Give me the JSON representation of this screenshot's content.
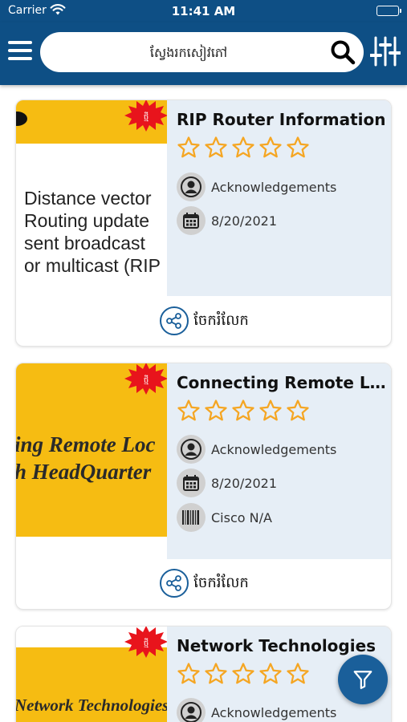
{
  "status_bar": {
    "carrier": "Carrier",
    "time": "11:41 AM"
  },
  "search": {
    "placeholder": "ស្វែងរកសៀវភៅ"
  },
  "colors": {
    "primary": "#0e4f85",
    "accent_yellow": "#f6bc12",
    "star": "#f5a623",
    "badge_red": "#e8141c",
    "info_bg": "#e6eef6"
  },
  "share_label": "ចែករំលែក",
  "cards": [
    {
      "title": "RIP Router Information",
      "rating_stars": 0,
      "author": "Acknowledgements",
      "date": "8/20/2021",
      "thumbnail_lines": [
        "Distance vector",
        "Routing update",
        "sent broadcast",
        "or multicast (RIP"
      ]
    },
    {
      "title": "Connecting Remote L...",
      "rating_stars": 0,
      "author": "Acknowledgements",
      "date": "8/20/2021",
      "publisher": "Cisco N/A",
      "thumbnail_lines": [
        "ing Remote Loc",
        "h HeadQuarter"
      ]
    },
    {
      "title": "Network Technologies",
      "rating_stars": 0,
      "author": "Acknowledgements",
      "thumbnail_lines": [
        "Network Technologies"
      ]
    }
  ]
}
